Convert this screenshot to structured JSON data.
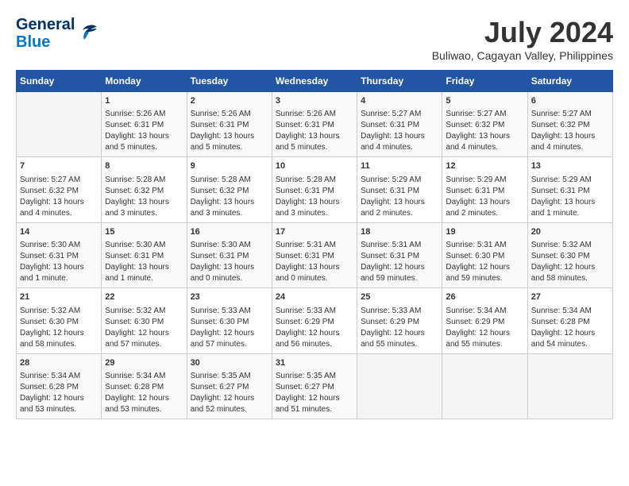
{
  "header": {
    "logo_line1": "General",
    "logo_line2": "Blue",
    "month": "July 2024",
    "location": "Buliwao, Cagayan Valley, Philippines"
  },
  "weekdays": [
    "Sunday",
    "Monday",
    "Tuesday",
    "Wednesday",
    "Thursday",
    "Friday",
    "Saturday"
  ],
  "weeks": [
    [
      {
        "day": "",
        "content": ""
      },
      {
        "day": "1",
        "content": "Sunrise: 5:26 AM\nSunset: 6:31 PM\nDaylight: 13 hours\nand 5 minutes."
      },
      {
        "day": "2",
        "content": "Sunrise: 5:26 AM\nSunset: 6:31 PM\nDaylight: 13 hours\nand 5 minutes."
      },
      {
        "day": "3",
        "content": "Sunrise: 5:26 AM\nSunset: 6:31 PM\nDaylight: 13 hours\nand 5 minutes."
      },
      {
        "day": "4",
        "content": "Sunrise: 5:27 AM\nSunset: 6:31 PM\nDaylight: 13 hours\nand 4 minutes."
      },
      {
        "day": "5",
        "content": "Sunrise: 5:27 AM\nSunset: 6:32 PM\nDaylight: 13 hours\nand 4 minutes."
      },
      {
        "day": "6",
        "content": "Sunrise: 5:27 AM\nSunset: 6:32 PM\nDaylight: 13 hours\nand 4 minutes."
      }
    ],
    [
      {
        "day": "7",
        "content": "Sunrise: 5:27 AM\nSunset: 6:32 PM\nDaylight: 13 hours\nand 4 minutes."
      },
      {
        "day": "8",
        "content": "Sunrise: 5:28 AM\nSunset: 6:32 PM\nDaylight: 13 hours\nand 3 minutes."
      },
      {
        "day": "9",
        "content": "Sunrise: 5:28 AM\nSunset: 6:32 PM\nDaylight: 13 hours\nand 3 minutes."
      },
      {
        "day": "10",
        "content": "Sunrise: 5:28 AM\nSunset: 6:31 PM\nDaylight: 13 hours\nand 3 minutes."
      },
      {
        "day": "11",
        "content": "Sunrise: 5:29 AM\nSunset: 6:31 PM\nDaylight: 13 hours\nand 2 minutes."
      },
      {
        "day": "12",
        "content": "Sunrise: 5:29 AM\nSunset: 6:31 PM\nDaylight: 13 hours\nand 2 minutes."
      },
      {
        "day": "13",
        "content": "Sunrise: 5:29 AM\nSunset: 6:31 PM\nDaylight: 13 hours\nand 1 minute."
      }
    ],
    [
      {
        "day": "14",
        "content": "Sunrise: 5:30 AM\nSunset: 6:31 PM\nDaylight: 13 hours\nand 1 minute."
      },
      {
        "day": "15",
        "content": "Sunrise: 5:30 AM\nSunset: 6:31 PM\nDaylight: 13 hours\nand 1 minute."
      },
      {
        "day": "16",
        "content": "Sunrise: 5:30 AM\nSunset: 6:31 PM\nDaylight: 13 hours\nand 0 minutes."
      },
      {
        "day": "17",
        "content": "Sunrise: 5:31 AM\nSunset: 6:31 PM\nDaylight: 13 hours\nand 0 minutes."
      },
      {
        "day": "18",
        "content": "Sunrise: 5:31 AM\nSunset: 6:31 PM\nDaylight: 12 hours\nand 59 minutes."
      },
      {
        "day": "19",
        "content": "Sunrise: 5:31 AM\nSunset: 6:30 PM\nDaylight: 12 hours\nand 59 minutes."
      },
      {
        "day": "20",
        "content": "Sunrise: 5:32 AM\nSunset: 6:30 PM\nDaylight: 12 hours\nand 58 minutes."
      }
    ],
    [
      {
        "day": "21",
        "content": "Sunrise: 5:32 AM\nSunset: 6:30 PM\nDaylight: 12 hours\nand 58 minutes."
      },
      {
        "day": "22",
        "content": "Sunrise: 5:32 AM\nSunset: 6:30 PM\nDaylight: 12 hours\nand 57 minutes."
      },
      {
        "day": "23",
        "content": "Sunrise: 5:33 AM\nSunset: 6:30 PM\nDaylight: 12 hours\nand 57 minutes."
      },
      {
        "day": "24",
        "content": "Sunrise: 5:33 AM\nSunset: 6:29 PM\nDaylight: 12 hours\nand 56 minutes."
      },
      {
        "day": "25",
        "content": "Sunrise: 5:33 AM\nSunset: 6:29 PM\nDaylight: 12 hours\nand 55 minutes."
      },
      {
        "day": "26",
        "content": "Sunrise: 5:34 AM\nSunset: 6:29 PM\nDaylight: 12 hours\nand 55 minutes."
      },
      {
        "day": "27",
        "content": "Sunrise: 5:34 AM\nSunset: 6:28 PM\nDaylight: 12 hours\nand 54 minutes."
      }
    ],
    [
      {
        "day": "28",
        "content": "Sunrise: 5:34 AM\nSunset: 6:28 PM\nDaylight: 12 hours\nand 53 minutes."
      },
      {
        "day": "29",
        "content": "Sunrise: 5:34 AM\nSunset: 6:28 PM\nDaylight: 12 hours\nand 53 minutes."
      },
      {
        "day": "30",
        "content": "Sunrise: 5:35 AM\nSunset: 6:27 PM\nDaylight: 12 hours\nand 52 minutes."
      },
      {
        "day": "31",
        "content": "Sunrise: 5:35 AM\nSunset: 6:27 PM\nDaylight: 12 hours\nand 51 minutes."
      },
      {
        "day": "",
        "content": ""
      },
      {
        "day": "",
        "content": ""
      },
      {
        "day": "",
        "content": ""
      }
    ]
  ]
}
